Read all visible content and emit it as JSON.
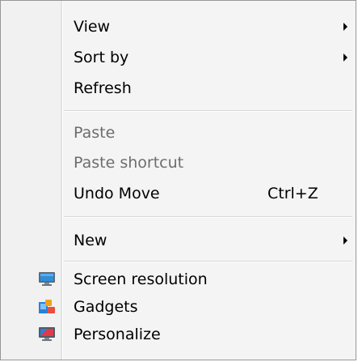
{
  "menu": {
    "items": [
      {
        "label": "View",
        "submenu": true
      },
      {
        "label": "Sort by",
        "submenu": true
      },
      {
        "label": "Refresh"
      },
      {
        "label": "Paste",
        "disabled": true
      },
      {
        "label": "Paste shortcut",
        "disabled": true
      },
      {
        "label": "Undo Move",
        "shortcut": "Ctrl+Z"
      },
      {
        "label": "New",
        "submenu": true
      },
      {
        "label": "Screen resolution",
        "icon": "monitor-icon"
      },
      {
        "label": "Gadgets",
        "icon": "gadgets-icon"
      },
      {
        "label": "Personalize",
        "icon": "personalize-icon"
      }
    ]
  }
}
